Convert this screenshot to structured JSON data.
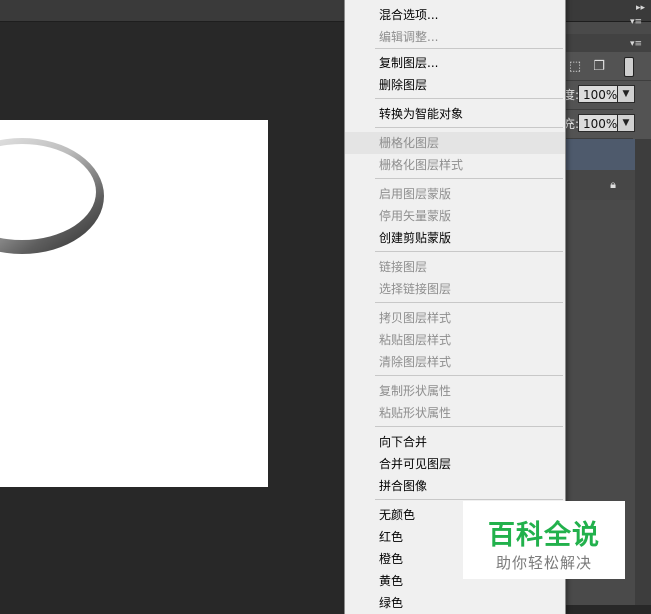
{
  "context_menu": {
    "items": [
      {
        "label": "混合选项...",
        "enabled": true
      },
      {
        "label": "编辑调整...",
        "enabled": false
      },
      {
        "label": "复制图层...",
        "enabled": true
      },
      {
        "label": "删除图层",
        "enabled": true
      },
      {
        "label": "转换为智能对象",
        "enabled": true
      },
      {
        "label": "栅格化图层",
        "enabled": false,
        "highlighted": true
      },
      {
        "label": "栅格化图层样式",
        "enabled": false
      },
      {
        "label": "启用图层蒙版",
        "enabled": false
      },
      {
        "label": "停用矢量蒙版",
        "enabled": false
      },
      {
        "label": "创建剪贴蒙版",
        "enabled": true
      },
      {
        "label": "链接图层",
        "enabled": false
      },
      {
        "label": "选择链接图层",
        "enabled": false
      },
      {
        "label": "拷贝图层样式",
        "enabled": false
      },
      {
        "label": "粘贴图层样式",
        "enabled": false
      },
      {
        "label": "清除图层样式",
        "enabled": false
      },
      {
        "label": "复制形状属性",
        "enabled": false
      },
      {
        "label": "粘贴形状属性",
        "enabled": false
      },
      {
        "label": "向下合并",
        "enabled": true
      },
      {
        "label": "合并可见图层",
        "enabled": true
      },
      {
        "label": "拼合图像",
        "enabled": true
      },
      {
        "label": "无颜色",
        "enabled": true
      },
      {
        "label": "红色",
        "enabled": true
      },
      {
        "label": "橙色",
        "enabled": true
      },
      {
        "label": "黄色",
        "enabled": true
      },
      {
        "label": "绿色",
        "enabled": true
      }
    ]
  },
  "layers_panel": {
    "opacity_label_suffix": "度:",
    "opacity_value": "100%",
    "fill_label_suffix": "充:",
    "fill_value": "100%"
  },
  "watermark": {
    "title": "百科全说",
    "subtitle": "助你轻松解决"
  },
  "icons": {
    "lock": "lock-icon",
    "dropdown": "chevron-down-icon",
    "panel_menu": "panel-menu-icon",
    "collapse": "double-chevron-right-icon"
  },
  "colors": {
    "workspace": "#282828",
    "panel": "#535353",
    "menu_bg": "#f0f0f0",
    "selected_layer": "#4e5a6c",
    "watermark_green": "#22b14c"
  }
}
